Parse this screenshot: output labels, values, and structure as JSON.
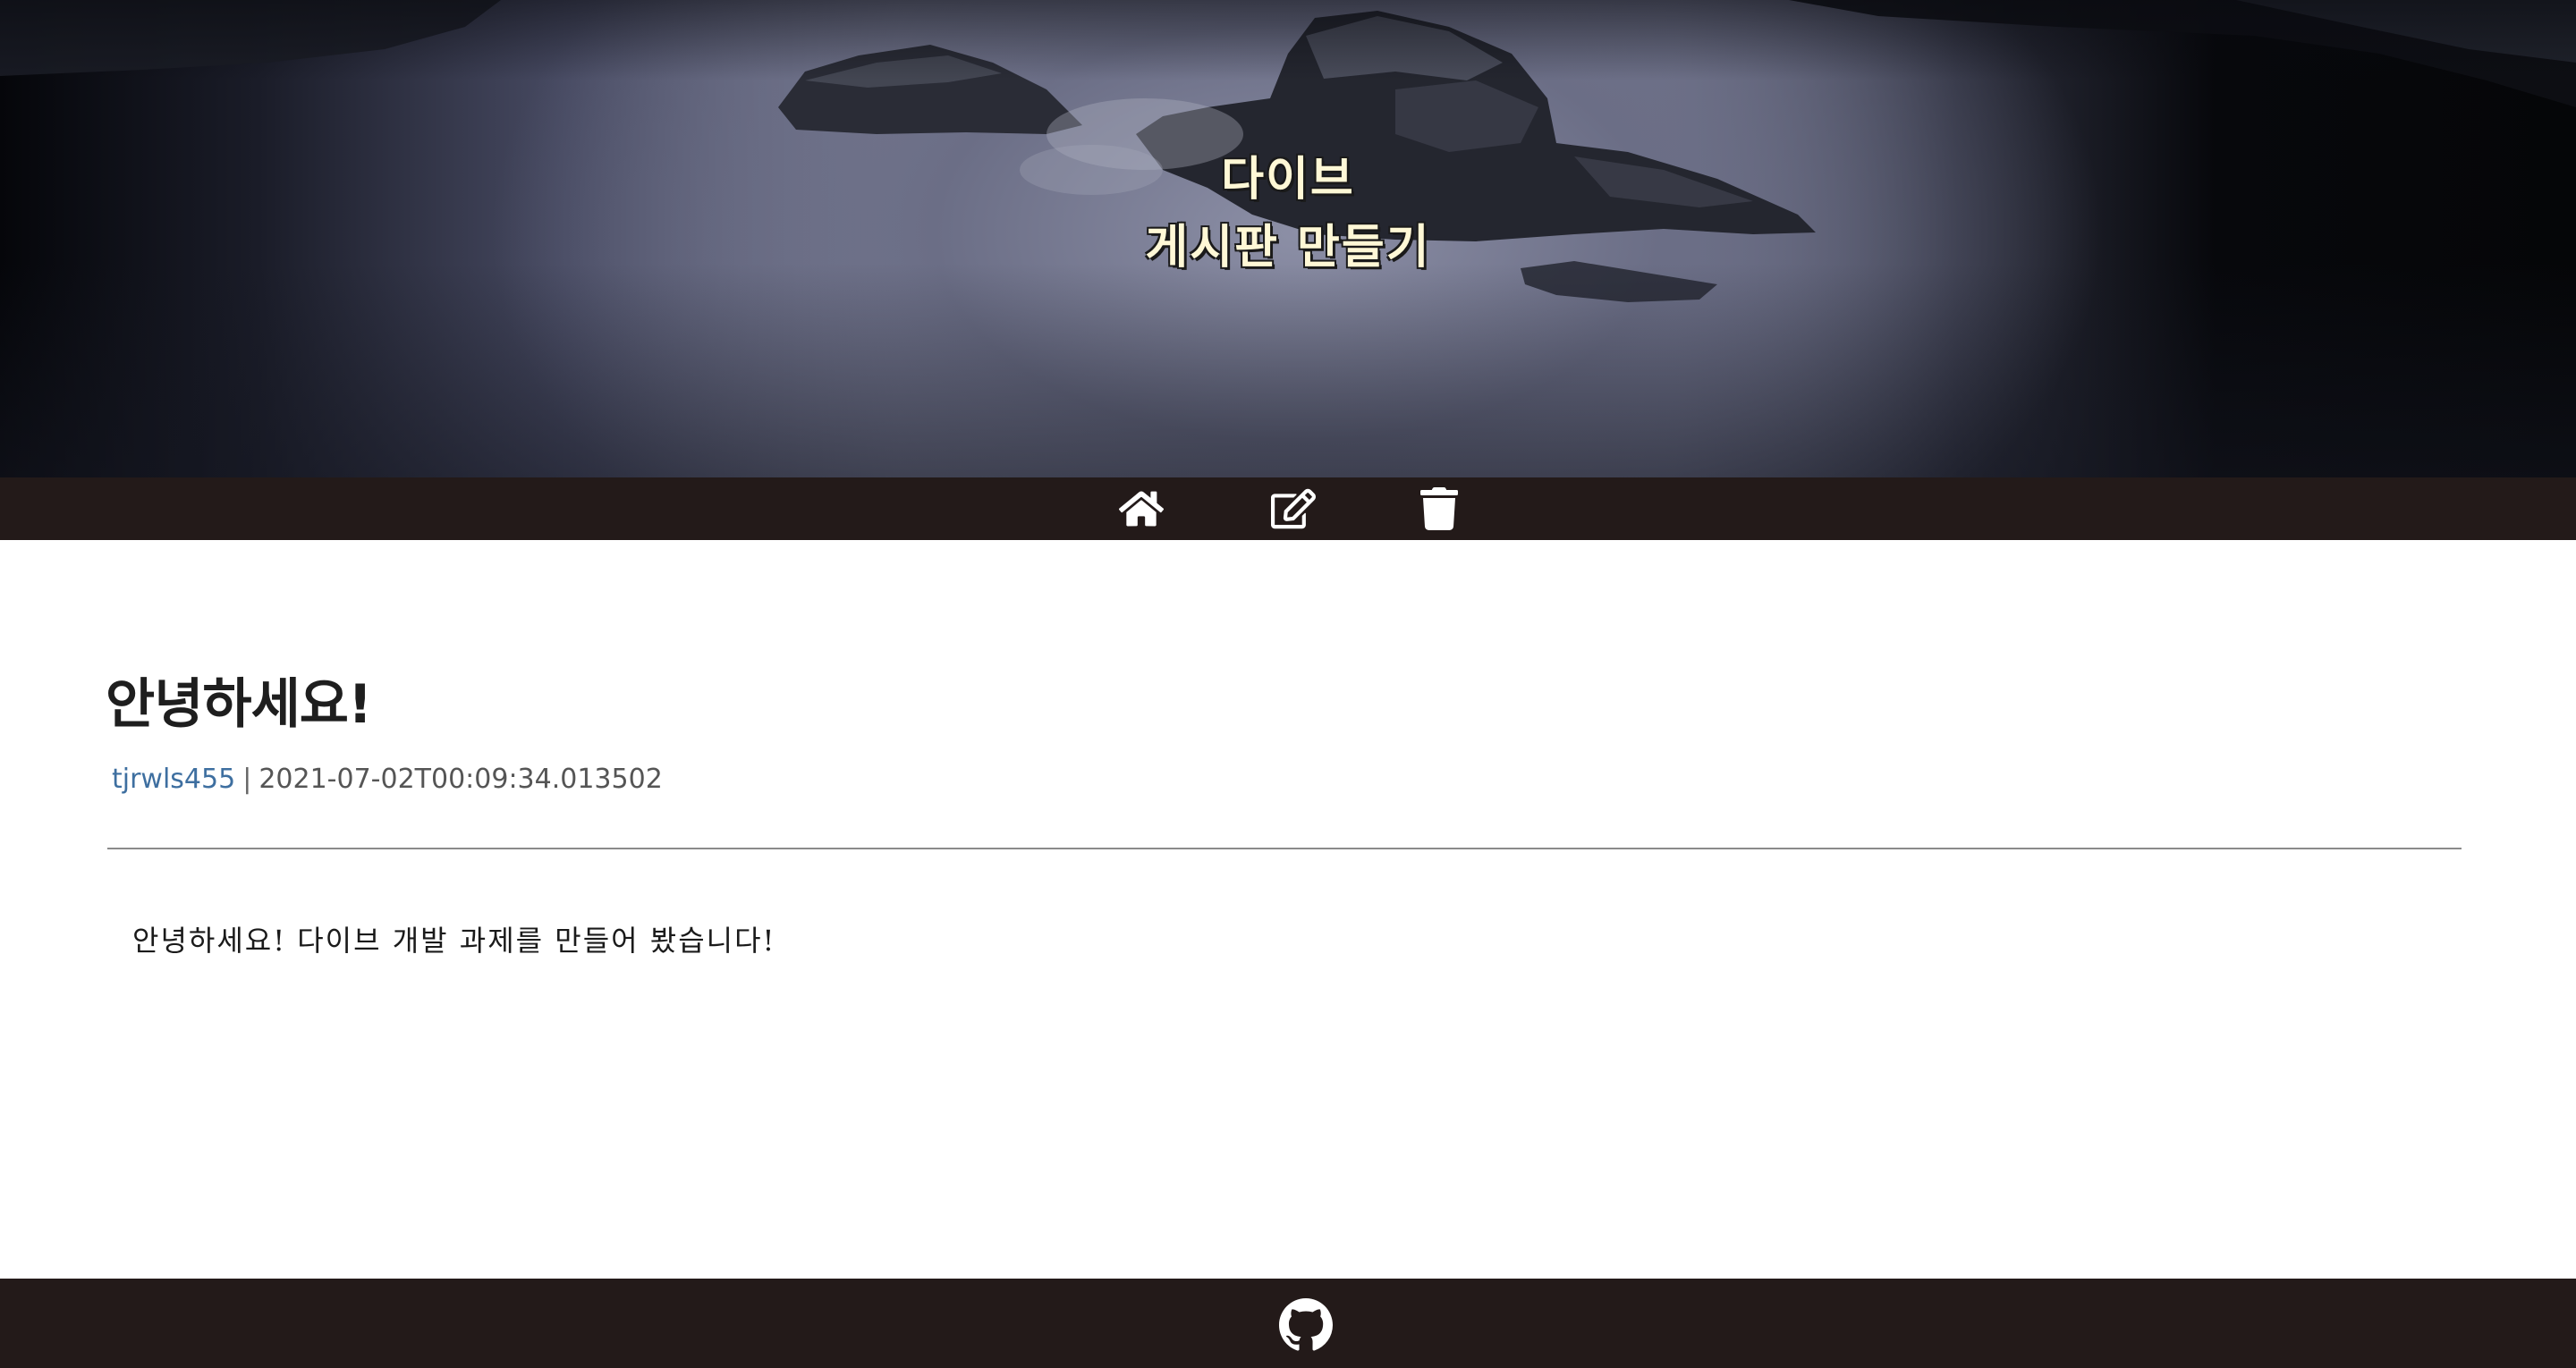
{
  "hero": {
    "title_line1": "다이브",
    "title_line2": "게시판 만들기",
    "text_color": "#fff8d6"
  },
  "nav": {
    "background": "#231a19",
    "items": [
      {
        "icon": "home-icon"
      },
      {
        "icon": "edit-icon"
      },
      {
        "icon": "trash-icon"
      }
    ]
  },
  "post": {
    "title": "안녕하세요!",
    "author": "tjrwls455",
    "separator": "|",
    "created_at": "2021-07-02T00:09:34.013502",
    "content": "안녕하세요! 다이브 개발 과제를 만들어 봤습니다!",
    "author_color": "#3e6fa0"
  },
  "footer": {
    "background": "#231a19",
    "icon": "github-icon"
  }
}
